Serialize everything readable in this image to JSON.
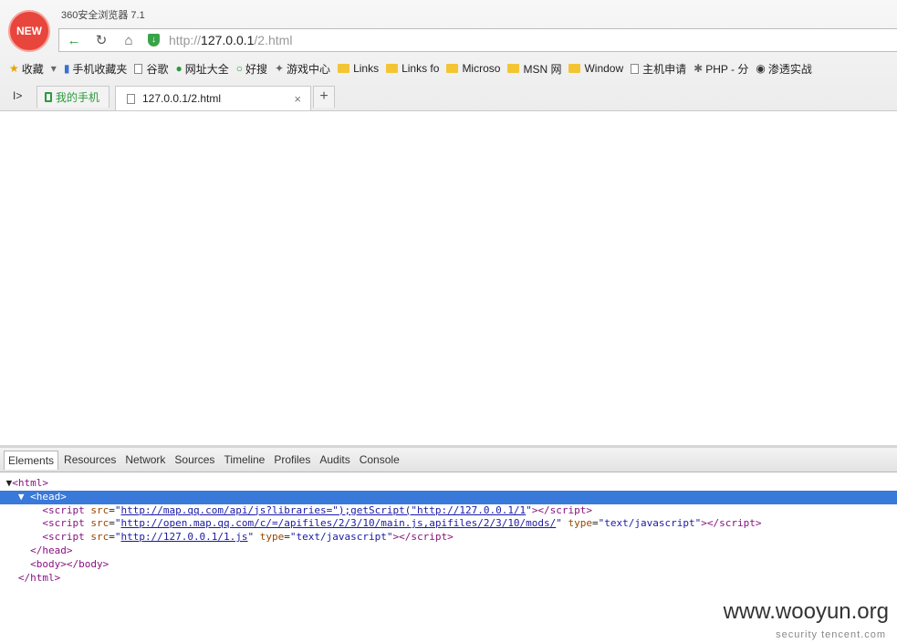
{
  "window": {
    "title": "360安全浏览器 7.1",
    "logo_text": "NEW"
  },
  "navbar": {
    "url_scheme": "http://",
    "url_host": "127.0.0.1",
    "url_path": "/2.html"
  },
  "bookmarks": [
    {
      "label": "收藏",
      "icon": "star-icon"
    },
    {
      "label": "手机收藏夹",
      "icon": "phone-icon"
    },
    {
      "label": "谷歌",
      "icon": "page-icon"
    },
    {
      "label": "网址大全",
      "icon": "globe-icon"
    },
    {
      "label": "好搜",
      "icon": "search-icon"
    },
    {
      "label": "游戏中心",
      "icon": "gamepad-icon"
    },
    {
      "label": "Links",
      "icon": "folder-icon"
    },
    {
      "label": "Links fo",
      "icon": "folder-icon"
    },
    {
      "label": "Microso",
      "icon": "folder-icon"
    },
    {
      "label": "MSN 网",
      "icon": "folder-icon"
    },
    {
      "label": "Window",
      "icon": "folder-icon"
    },
    {
      "label": "主机申请",
      "icon": "page-icon"
    },
    {
      "label": "PHP - 分",
      "icon": "php-icon"
    },
    {
      "label": "渗透实战",
      "icon": "mask-icon"
    }
  ],
  "tabs": {
    "phone_tab": "我的手机",
    "active_tab": "127.0.0.1/2.html",
    "close": "×",
    "new": "+"
  },
  "devtools": {
    "tabs": [
      "Elements",
      "Resources",
      "Network",
      "Sources",
      "Timeline",
      "Profiles",
      "Audits",
      "Console"
    ],
    "dom": {
      "html_open": "<html>",
      "head_open": "<head>",
      "s1_src": "http://map.qq.com/api/js?libraries=\");getScript(\"http://127.0.0.1/1",
      "s2_src": "http://open.map.qq.com/c/=/apifiles/2/3/10/main.js,apifiles/2/3/10/mods/",
      "s3_src": "http://127.0.0.1/1.js",
      "type_val": "text/javascript",
      "head_close": "</head>",
      "body": "<body></body>",
      "html_close": "</html>"
    }
  },
  "watermark": {
    "site": "www.wooyun.org",
    "sub": "security tencent.com"
  }
}
